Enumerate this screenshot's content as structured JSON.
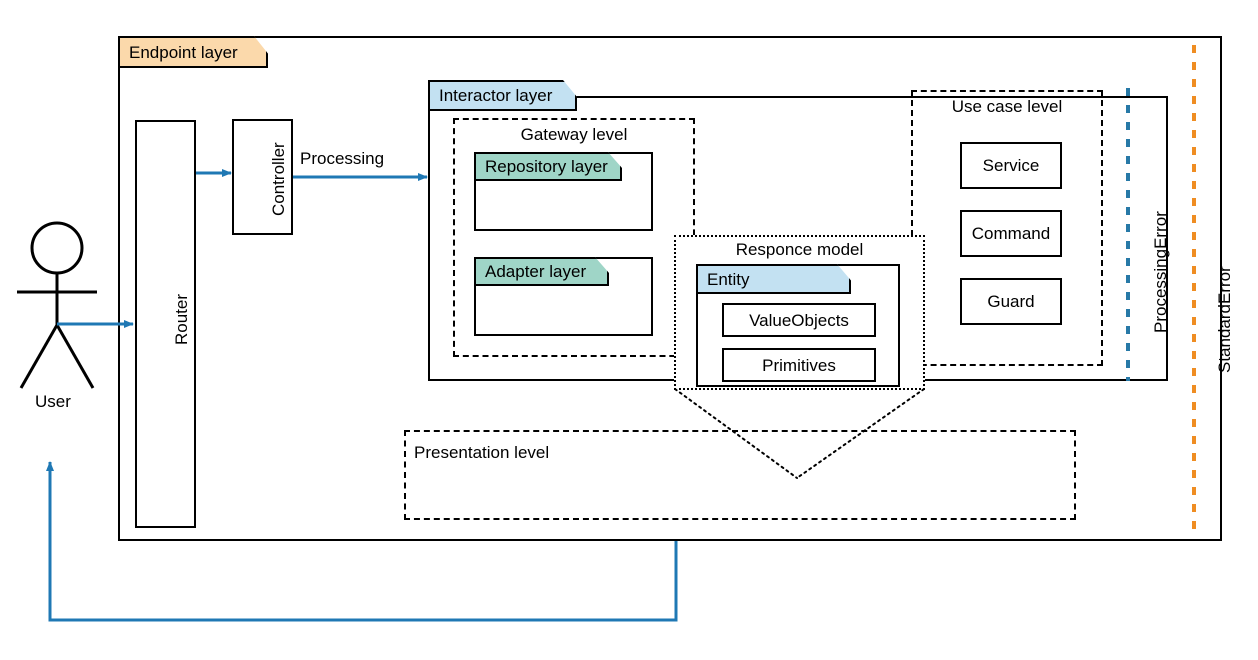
{
  "diagram": {
    "actor": {
      "label": "User"
    },
    "endpoint_layer": {
      "label": "Endpoint layer"
    },
    "router": {
      "label": "Router"
    },
    "controller": {
      "label": "Controller"
    },
    "processing_arrow": {
      "label": "Processing"
    },
    "interactor_layer": {
      "label": "Interactor layer"
    },
    "gateway_level": {
      "label": "Gateway level"
    },
    "repository_layer": {
      "label": "Repository layer"
    },
    "adapter_layer": {
      "label": "Adapter layer"
    },
    "responce_model": {
      "label": "Responce model"
    },
    "entity": {
      "label": "Entity"
    },
    "value_objects": {
      "label": "ValueObjects"
    },
    "primitives": {
      "label": "Primitives"
    },
    "use_case_level": {
      "label": "Use case level",
      "items": [
        {
          "label": "Service"
        },
        {
          "label": "Command"
        },
        {
          "label": "Guard"
        }
      ]
    },
    "presentation_level": {
      "label": "Presentation level"
    },
    "processing_error": {
      "label": "ProcessingError"
    },
    "standard_error": {
      "label": "StandardError"
    },
    "colors": {
      "accent_blue": "#1f78b4",
      "tab_orange": "#fbd9ab",
      "tab_blue": "#c3e1f2",
      "tab_teal": "#9fd5c7",
      "processing_error_line": "#2779a7",
      "standard_error_line": "#ef8d22",
      "stroke": "#000000"
    }
  }
}
